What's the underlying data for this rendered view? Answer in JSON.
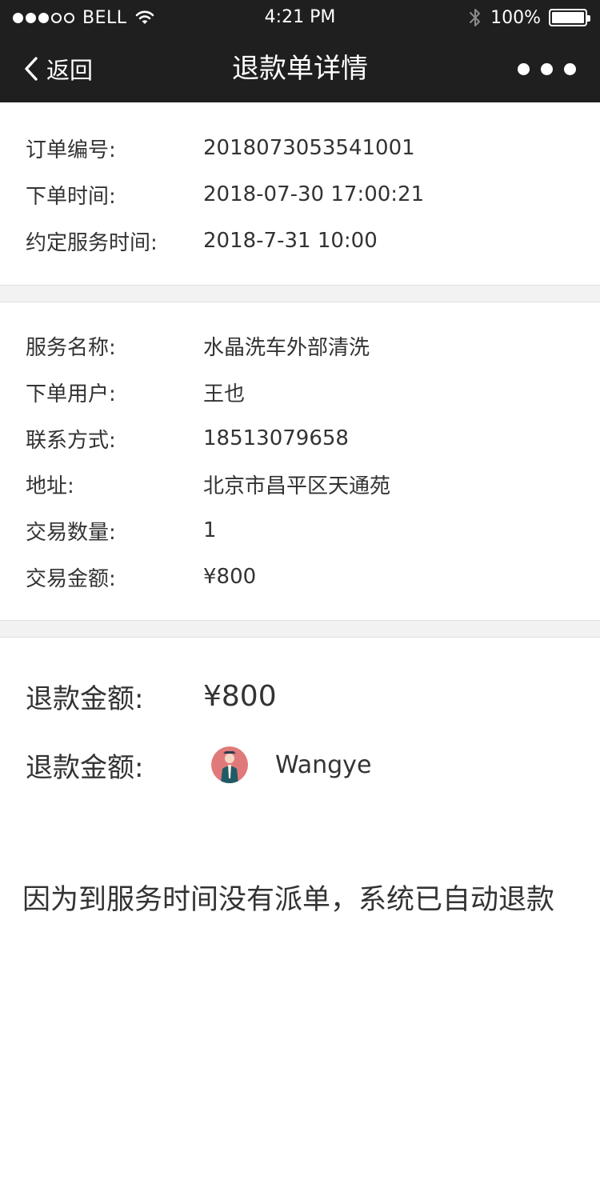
{
  "status_bar": {
    "carrier": "BELL",
    "signal_bars_filled": 3,
    "signal_bars_total": 5,
    "time": "4:21 PM",
    "battery": "100%",
    "battery_level": 1.0,
    "icons": [
      "wifi-icon",
      "bluetooth-icon",
      "battery-icon"
    ]
  },
  "nav": {
    "back_label": "返回",
    "title": "退款单详情",
    "back_icon": "chevron-left-icon",
    "more_icon": "more-dots-icon"
  },
  "order": {
    "number_label": "订单编号:",
    "number": "2018073053541001",
    "time_label": "下单时间:",
    "time": "2018-07-30 17:00:21",
    "service_time_label": "约定服务时间:",
    "service_time": "2018-7-31 10:00"
  },
  "details": {
    "service_name_label": "服务名称:",
    "service_name": "水晶洗车外部清洗",
    "user_label": "下单用户:",
    "user": "王也",
    "contact_label": "联系方式:",
    "contact": "18513079658",
    "address_label": "地址:",
    "address": "北京市昌平区天通苑",
    "quantity_label": "交易数量:",
    "quantity": "1",
    "amount_label": "交易金额:",
    "amount": "¥800"
  },
  "refund": {
    "amount_label": "退款金额:",
    "amount": "¥800",
    "person_label": "退款金额:",
    "person_name": "Wangye"
  },
  "notice": "因为到服务时间没有派单，系统已自动退款",
  "colors": {
    "header_bg": "#1f1f1f",
    "page_bg": "#ffffff",
    "divider_bg": "#f2f2f2",
    "text": "#333333"
  }
}
